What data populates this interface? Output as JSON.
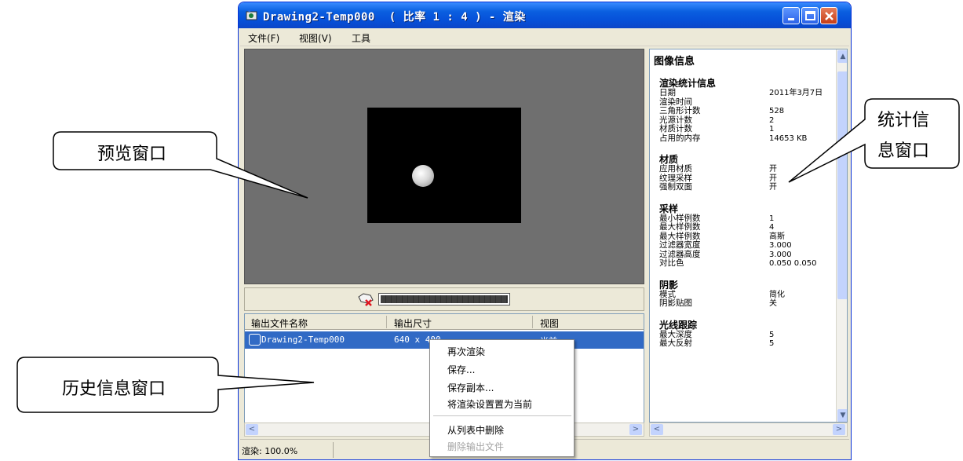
{
  "window": {
    "title": "Drawing2-Temp000  ( 比率 1 : 4 ) - 渲染"
  },
  "menu": {
    "items": [
      "文件(F)",
      "视图(V)",
      "工具"
    ]
  },
  "history": {
    "columns": [
      "输出文件名称",
      "输出尺寸",
      "视图"
    ],
    "rows": [
      {
        "name": "Drawing2-Temp000",
        "size": "640 x 400",
        "view": "当前"
      }
    ]
  },
  "stats": {
    "title": "图像信息",
    "sections": [
      {
        "title": "渲染统计信息",
        "rows": [
          {
            "k": "日期",
            "v": "2011年3月7日"
          },
          {
            "k": "渲染时间",
            "v": ""
          },
          {
            "k": "三角形计数",
            "v": "528"
          },
          {
            "k": "光源计数",
            "v": "2"
          },
          {
            "k": "材质计数",
            "v": "1"
          },
          {
            "k": "占用的内存",
            "v": "14653 KB"
          }
        ]
      },
      {
        "title": "材质",
        "rows": [
          {
            "k": "应用材质",
            "v": "开"
          },
          {
            "k": "纹理采样",
            "v": "开"
          },
          {
            "k": "强制双面",
            "v": "开"
          }
        ]
      },
      {
        "title": "采样",
        "rows": [
          {
            "k": "最小样例数",
            "v": "1"
          },
          {
            "k": "最大样例数",
            "v": "4"
          },
          {
            "k": "最大样例数",
            "v": "高斯"
          },
          {
            "k": "过滤器宽度",
            "v": "3.000"
          },
          {
            "k": "过滤器高度",
            "v": "3.000"
          },
          {
            "k": "对比色",
            "v": "0.050 0.050"
          }
        ]
      },
      {
        "title": "阴影",
        "rows": [
          {
            "k": "模式",
            "v": "简化"
          },
          {
            "k": "阴影贴图",
            "v": "关"
          }
        ]
      },
      {
        "title": "光线跟踪",
        "rows": [
          {
            "k": "最大深度",
            "v": "5"
          },
          {
            "k": "最大反射",
            "v": "5"
          }
        ]
      }
    ]
  },
  "context_menu": {
    "items": [
      {
        "label": "再次渲染",
        "enabled": true
      },
      {
        "label": "保存...",
        "enabled": true
      },
      {
        "label": "保存副本...",
        "enabled": true
      },
      {
        "label": "将渲染设置置为当前",
        "enabled": true
      },
      {
        "label": "从列表中删除",
        "enabled": true
      },
      {
        "label": "删除输出文件",
        "enabled": false
      }
    ]
  },
  "status": {
    "text": "渲染: 100.0%"
  },
  "callouts": {
    "preview": "预览窗口",
    "stats_line1": "统计信",
    "stats_line2": "息窗口",
    "history": "历史信息窗口"
  },
  "colors": {
    "titlebar": "#0650d9",
    "selection": "#316ac5",
    "preview_bg": "#6f6f6f"
  }
}
